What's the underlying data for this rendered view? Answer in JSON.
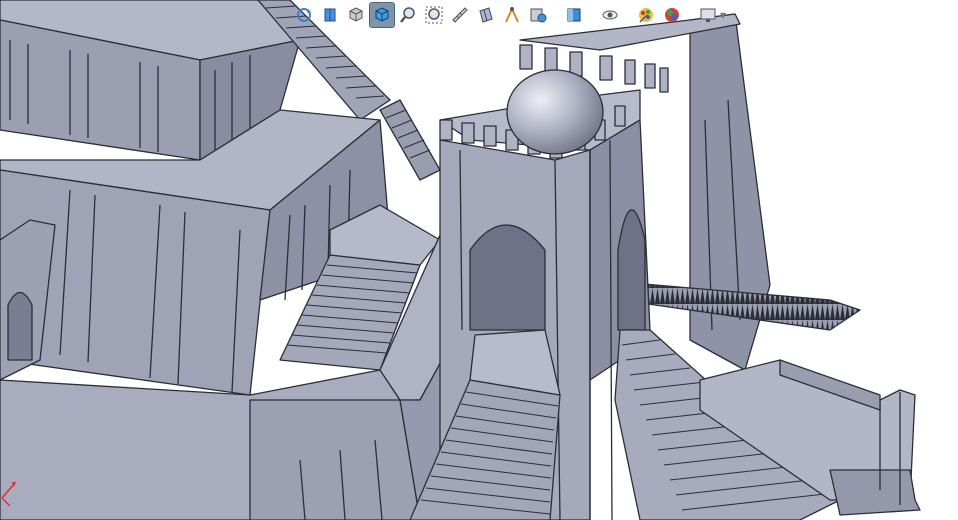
{
  "app": {
    "kind": "CAD 3D viewport",
    "model_color": "#a7aabb",
    "edge_color": "#2b2d38",
    "background": "#ffffff"
  },
  "toolbar": {
    "items": [
      {
        "id": "rotate",
        "icon": "rotate-view-icon",
        "active": false
      },
      {
        "id": "section",
        "icon": "section-view-icon",
        "active": false
      },
      {
        "id": "display-style",
        "icon": "display-style-cube-icon",
        "active": false
      },
      {
        "id": "view-orientation",
        "icon": "view-orientation-cube-icon",
        "active": true
      },
      {
        "id": "zoom",
        "icon": "zoom-icon",
        "active": false
      },
      {
        "id": "zoom-area",
        "icon": "zoom-area-icon",
        "active": false
      },
      {
        "id": "measure",
        "icon": "measure-icon",
        "active": false
      },
      {
        "id": "section-plane",
        "icon": "section-plane-icon",
        "active": false
      },
      {
        "id": "analysis",
        "icon": "analysis-tool-icon",
        "active": false
      },
      {
        "id": "view-settings",
        "icon": "view-settings-icon",
        "active": false
      },
      {
        "id": "standard-views",
        "icon": "standard-views-icon",
        "active": false
      },
      {
        "id": "hide-show",
        "icon": "hide-show-eye-icon",
        "active": false
      },
      {
        "id": "appearance",
        "icon": "edit-appearance-icon",
        "active": false
      },
      {
        "id": "scenes",
        "icon": "apply-scene-icon",
        "active": false
      },
      {
        "id": "display-pane",
        "icon": "display-pane-monitor-icon",
        "active": false
      }
    ]
  },
  "triad": {
    "icon": "coordinate-triad-icon",
    "x_color": "#e03030"
  }
}
